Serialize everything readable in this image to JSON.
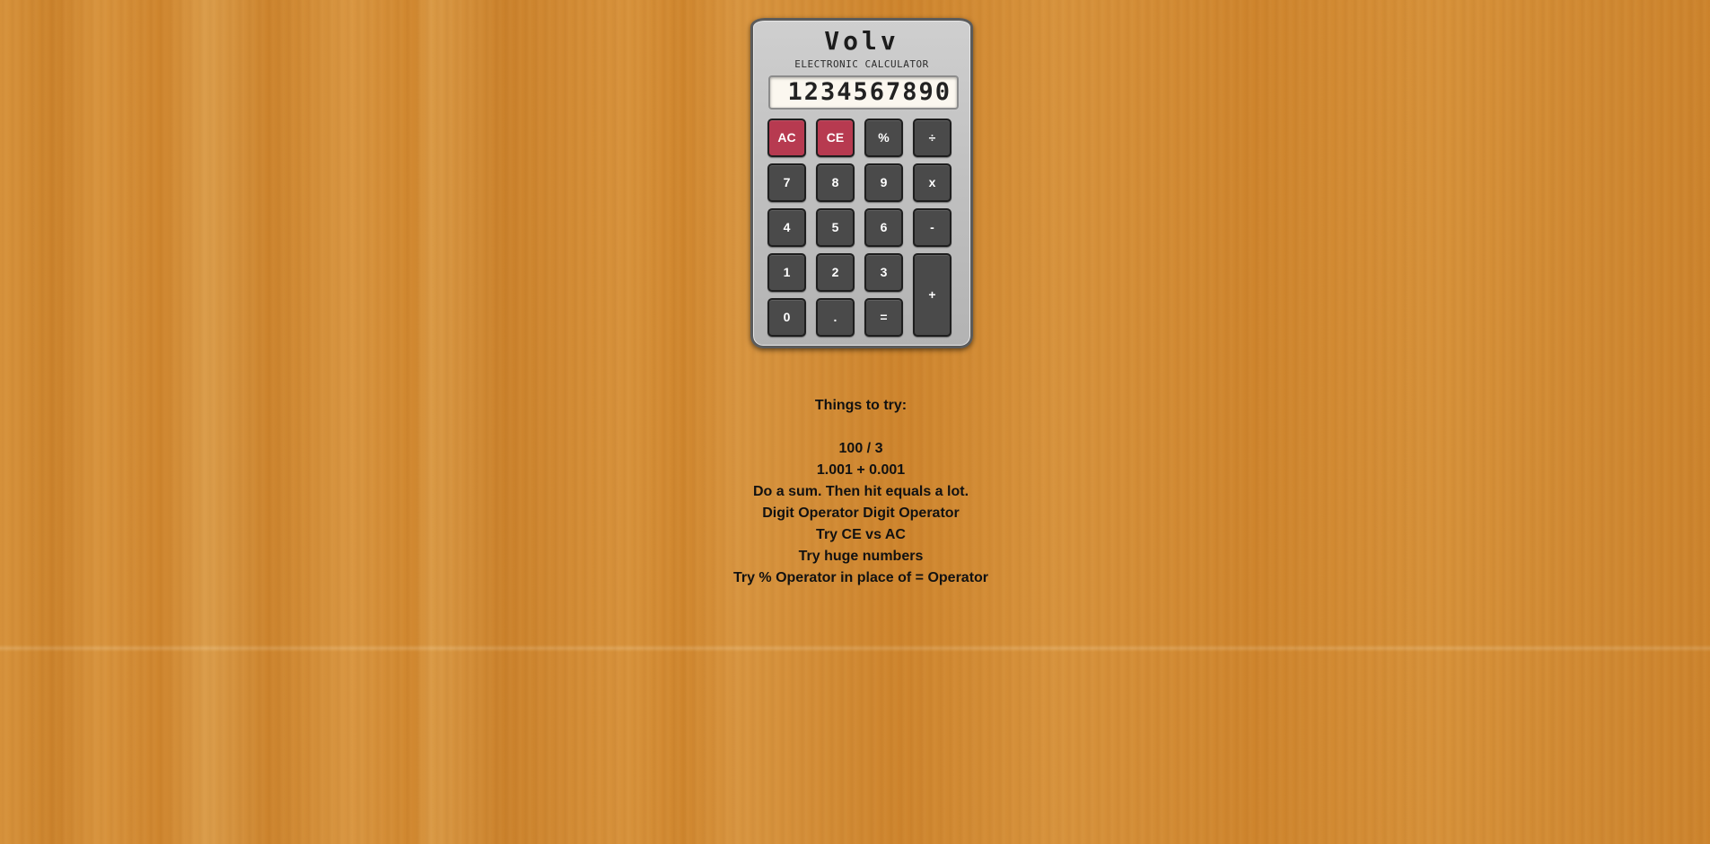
{
  "calculator": {
    "brand": "Volv",
    "subtitle": "ELECTRONIC CALCULATOR",
    "display": "1234567890",
    "keys": {
      "ac": "AC",
      "ce": "CE",
      "percent": "%",
      "divide": "÷",
      "seven": "7",
      "eight": "8",
      "nine": "9",
      "multiply": "x",
      "four": "4",
      "five": "5",
      "six": "6",
      "minus": "-",
      "one": "1",
      "two": "2",
      "three": "3",
      "plus": "+",
      "zero": "0",
      "decimal": ".",
      "equals": "="
    },
    "colors": {
      "clear_key": "#b73a50",
      "number_key": "#4a4a4a",
      "body": "#bdbdbd",
      "display_bg": "#fbf7ef"
    }
  },
  "tips": {
    "heading": "Things to try:",
    "items": [
      "100 / 3",
      "1.001 + 0.001",
      "Do a sum. Then hit equals a lot.",
      "Digit Operator Digit Operator",
      "Try CE vs AC",
      "Try huge numbers",
      "Try % Operator in place of = Operator"
    ]
  }
}
